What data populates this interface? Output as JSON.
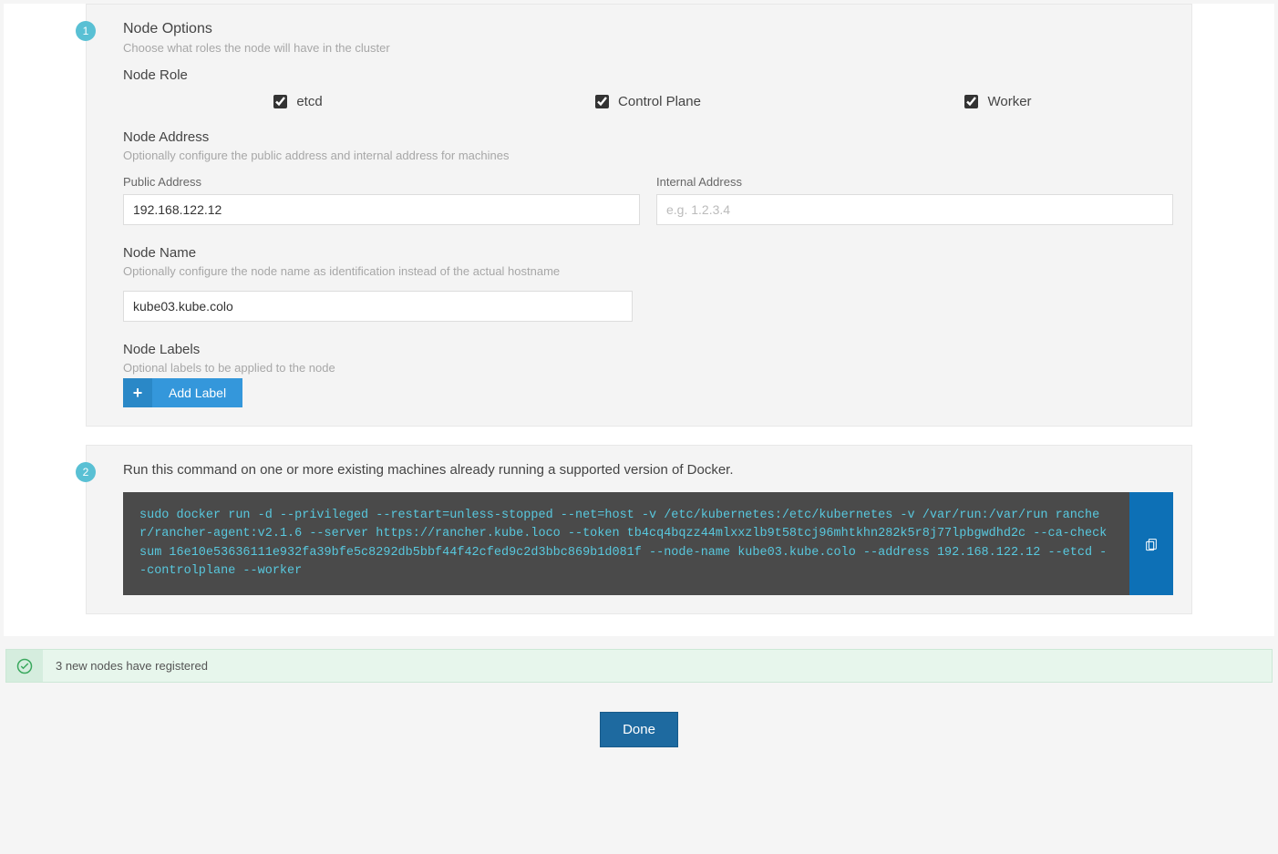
{
  "step1": {
    "badge": "1",
    "title": "Node Options",
    "subtitle": "Choose what roles the node will have in the cluster",
    "role_heading": "Node Role",
    "roles": {
      "etcd": "etcd",
      "control_plane": "Control Plane",
      "worker": "Worker"
    },
    "address": {
      "heading": "Node Address",
      "subtitle": "Optionally configure the public address and internal address for machines",
      "public_label": "Public Address",
      "public_value": "192.168.122.12",
      "internal_label": "Internal Address",
      "internal_placeholder": "e.g. 1.2.3.4"
    },
    "name": {
      "heading": "Node Name",
      "subtitle": "Optionally configure the node name as identification instead of the actual hostname",
      "value": "kube03.kube.colo"
    },
    "labels": {
      "heading": "Node Labels",
      "subtitle": "Optional labels to be applied to the node",
      "add_button": "Add Label",
      "plus": "+"
    }
  },
  "step2": {
    "badge": "2",
    "heading": "Run this command on one or more existing machines already running a supported version of Docker.",
    "command": "sudo docker run -d --privileged --restart=unless-stopped --net=host -v /etc/kubernetes:/etc/kubernetes -v /var/run:/var/run rancher/rancher-agent:v2.1.6 --server https://rancher.kube.loco --token tb4cq4bqzz44mlxxzlb9t58tcj96mhtkhn282k5r8j77lpbgwdhd2c --ca-checksum 16e10e53636111e932fa39bfe5c8292db5bbf44f42cfed9c2d3bbc869b1d081f --node-name kube03.kube.colo --address 192.168.122.12 --etcd --controlplane --worker"
  },
  "alert": {
    "text": "3 new nodes have registered"
  },
  "done_label": "Done"
}
